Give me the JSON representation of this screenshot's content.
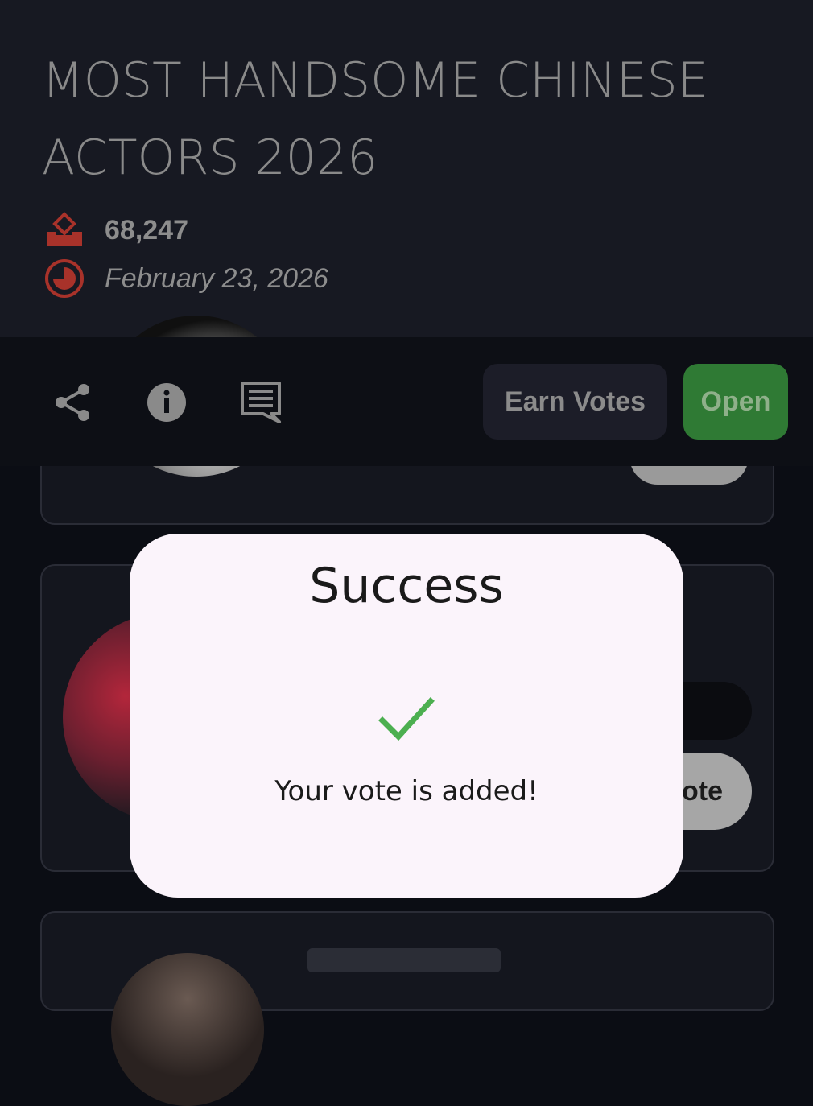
{
  "poll": {
    "title": "MOST HANDSOME CHINESE ACTORS 2026",
    "votes": "68,247",
    "date": "February 23, 2026"
  },
  "toolbar": {
    "share_icon": "share-icon",
    "info_icon": "info-icon",
    "comments_icon": "comments-icon",
    "earn_votes_label": "Earn Votes",
    "open_label": "Open"
  },
  "card": {
    "vote_label_partial": "ote"
  },
  "dialog": {
    "title": "Success",
    "message": "Your vote is added!",
    "icon": "check-icon"
  },
  "colors": {
    "accent_red": "#c0392b",
    "open_green": "#2f7a34",
    "check_green": "#4caf50",
    "dialog_bg": "#fbf4fb"
  }
}
